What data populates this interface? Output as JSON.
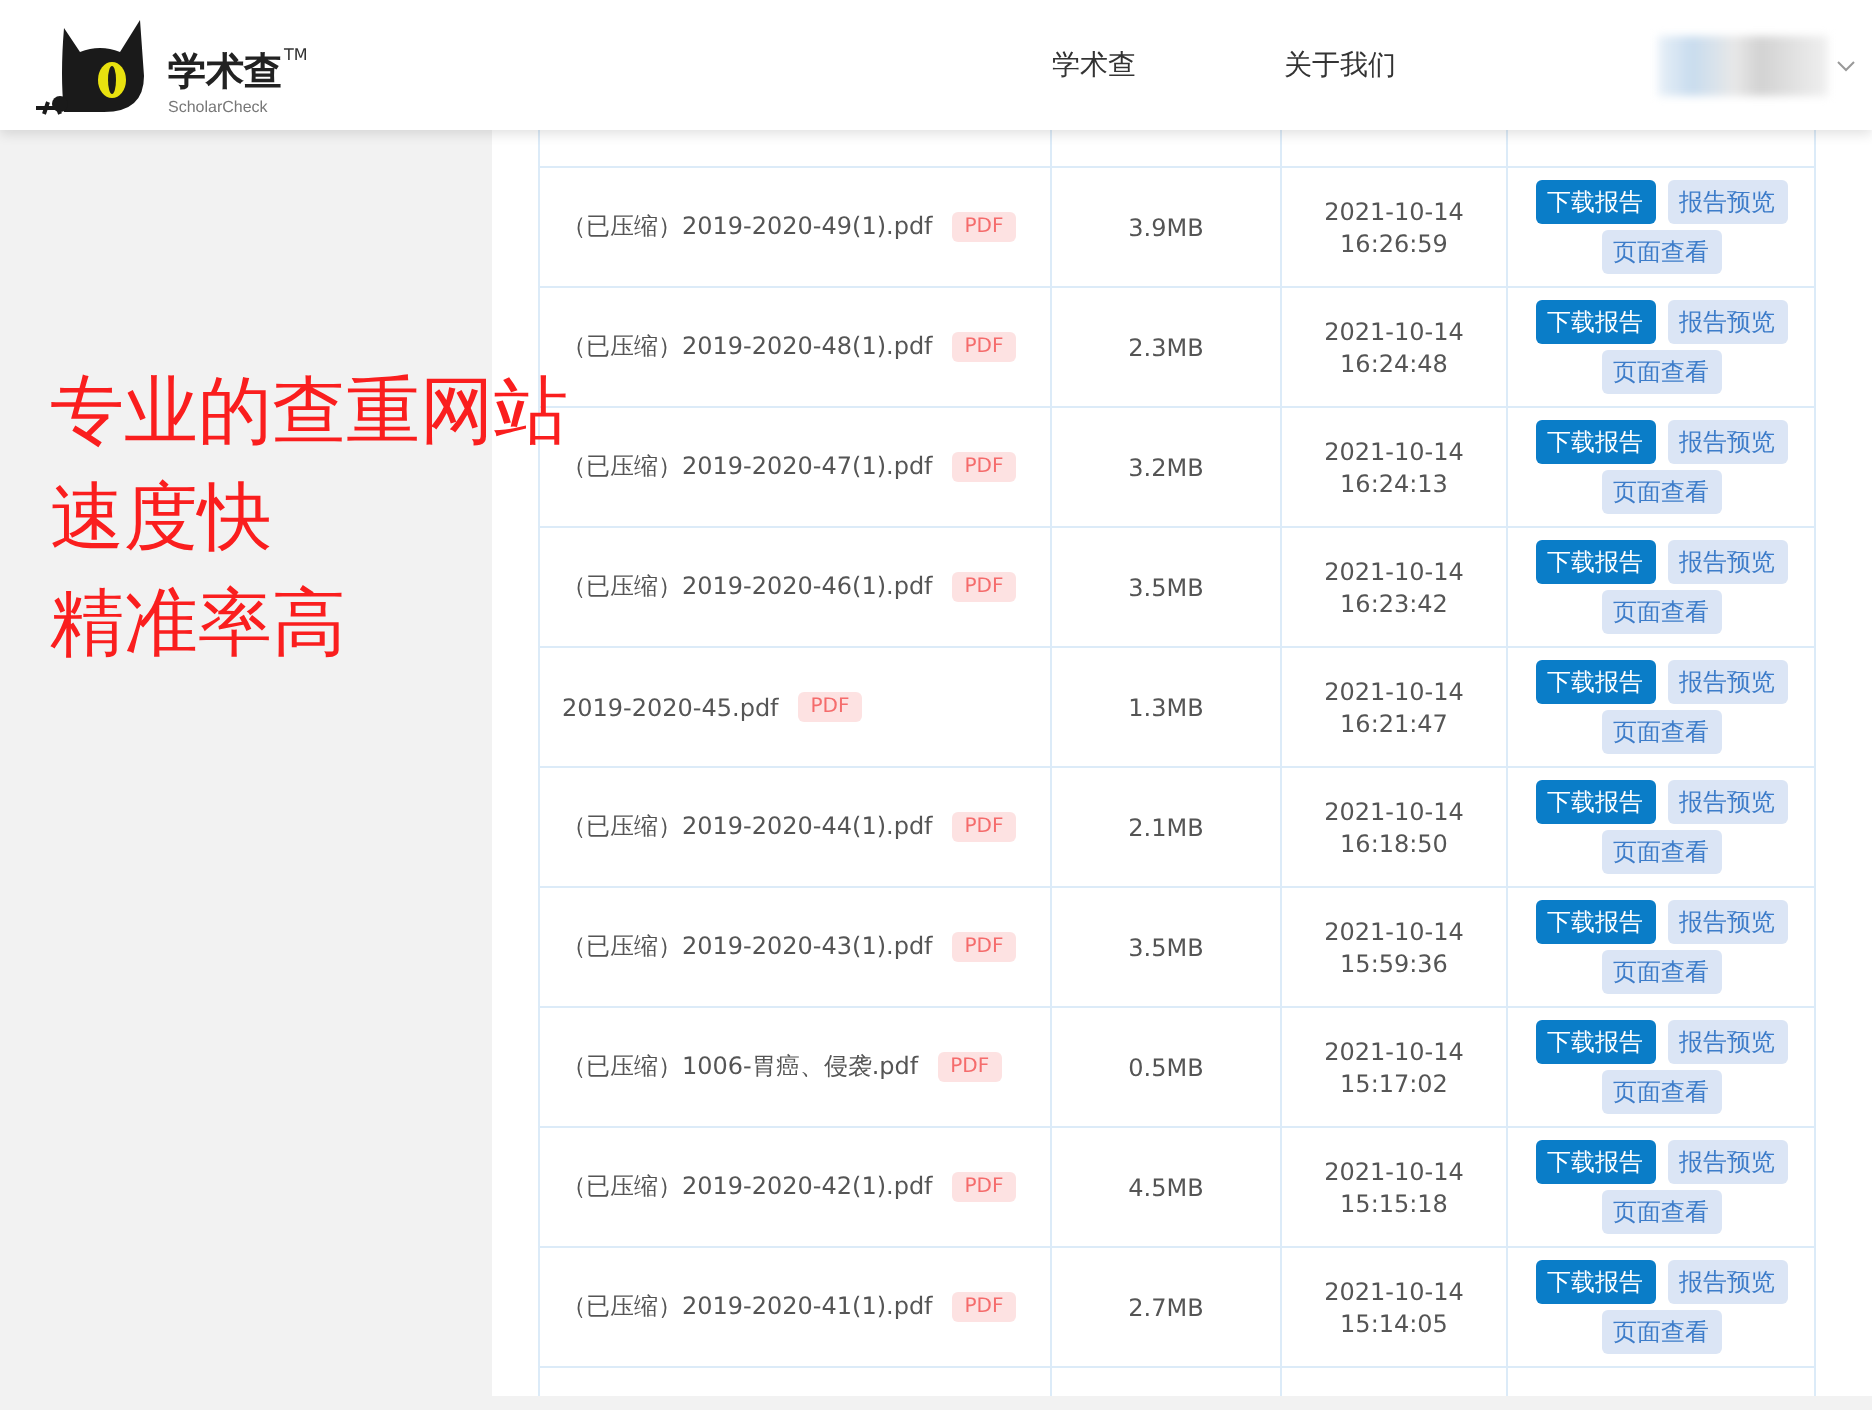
{
  "header": {
    "logo": {
      "name": "学术查",
      "tm": "TM",
      "subtitle": "ScholarCheck"
    },
    "nav": [
      "学术查",
      "关于我们"
    ]
  },
  "promo": [
    "专业的查重网站",
    "速度快",
    "精准率高"
  ],
  "table": {
    "rows": [
      {
        "name": "（已压缩）2019-2020-49(1).pdf",
        "badge": "PDF",
        "size": "3.9MB",
        "date": "2021-10-14",
        "time": "16:26:59",
        "actions": [
          "下载报告",
          "报告预览",
          "页面查看"
        ]
      },
      {
        "name": "（已压缩）2019-2020-48(1).pdf",
        "badge": "PDF",
        "size": "2.3MB",
        "date": "2021-10-14",
        "time": "16:24:48",
        "actions": [
          "下载报告",
          "报告预览",
          "页面查看"
        ]
      },
      {
        "name": "（已压缩）2019-2020-47(1).pdf",
        "badge": "PDF",
        "size": "3.2MB",
        "date": "2021-10-14",
        "time": "16:24:13",
        "actions": [
          "下载报告",
          "报告预览",
          "页面查看"
        ]
      },
      {
        "name": "（已压缩）2019-2020-46(1).pdf",
        "badge": "PDF",
        "size": "3.5MB",
        "date": "2021-10-14",
        "time": "16:23:42",
        "actions": [
          "下载报告",
          "报告预览",
          "页面查看"
        ]
      },
      {
        "name": "2019-2020-45.pdf",
        "badge": "PDF",
        "size": "1.3MB",
        "date": "2021-10-14",
        "time": "16:21:47",
        "actions": [
          "下载报告",
          "报告预览",
          "页面查看"
        ]
      },
      {
        "name": "（已压缩）2019-2020-44(1).pdf",
        "badge": "PDF",
        "size": "2.1MB",
        "date": "2021-10-14",
        "time": "16:18:50",
        "actions": [
          "下载报告",
          "报告预览",
          "页面查看"
        ]
      },
      {
        "name": "（已压缩）2019-2020-43(1).pdf",
        "badge": "PDF",
        "size": "3.5MB",
        "date": "2021-10-14",
        "time": "15:59:36",
        "actions": [
          "下载报告",
          "报告预览",
          "页面查看"
        ]
      },
      {
        "name": "（已压缩）1006-胃癌、侵袭.pdf",
        "badge": "PDF",
        "size": "0.5MB",
        "date": "2021-10-14",
        "time": "15:17:02",
        "actions": [
          "下载报告",
          "报告预览",
          "页面查看"
        ]
      },
      {
        "name": "（已压缩）2019-2020-42(1).pdf",
        "badge": "PDF",
        "size": "4.5MB",
        "date": "2021-10-14",
        "time": "15:15:18",
        "actions": [
          "下载报告",
          "报告预览",
          "页面查看"
        ]
      },
      {
        "name": "（已压缩）2019-2020-41(1).pdf",
        "badge": "PDF",
        "size": "2.7MB",
        "date": "2021-10-14",
        "time": "15:14:05",
        "actions": [
          "下载报告",
          "报告预览",
          "页面查看"
        ]
      }
    ]
  }
}
